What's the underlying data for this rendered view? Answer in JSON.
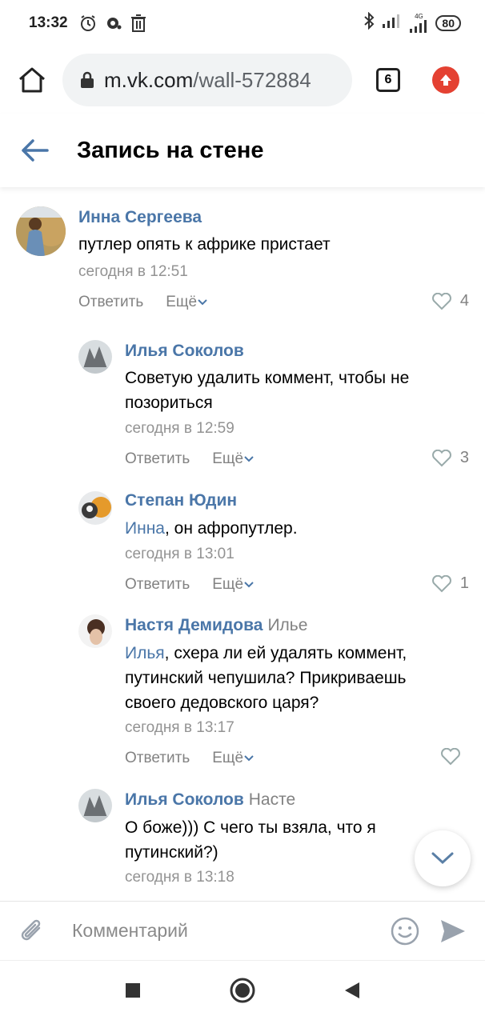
{
  "status_bar": {
    "time": "13:32",
    "battery": "80",
    "network": "4G",
    "icons": [
      "alarm-icon",
      "notification-icon",
      "trash-icon",
      "bluetooth-icon",
      "signal-icon",
      "signal-4g-icon",
      "battery-icon"
    ]
  },
  "browser": {
    "url_host": "m.vk.com",
    "url_path": "/wall-572884",
    "tab_count": "6",
    "accent": "#e44132"
  },
  "header": {
    "title": "Запись на стене"
  },
  "colors": {
    "link": "#4a76a8",
    "muted": "#939393"
  },
  "comments": [
    {
      "author": "Инна Сергеева",
      "reply_to": "",
      "mention": "",
      "text": "путлер опять к африке пристает",
      "date": "сегодня в 12:51",
      "reply_label": "Ответить",
      "more_label": "Ещё",
      "likes": "4"
    },
    {
      "author": "Илья Соколов",
      "reply_to": "",
      "mention": "",
      "text": "Советую удалить коммент, чтобы не позориться",
      "date": "сегодня в 12:59",
      "reply_label": "Ответить",
      "more_label": "Ещё",
      "likes": "3"
    },
    {
      "author": "Степан Юдин",
      "reply_to": "",
      "mention": "Инна",
      "text": ", он афропутлер.",
      "date": "сегодня в 13:01",
      "reply_label": "Ответить",
      "more_label": "Ещё",
      "likes": "1"
    },
    {
      "author": "Настя Демидова",
      "reply_to": "Илье",
      "mention": "Илья",
      "text": ", схера ли ей удалять коммент, путинский чепушила? Прикриваешь своего дедовского царя?",
      "date": "сегодня в 13:17",
      "reply_label": "Ответить",
      "more_label": "Ещё",
      "likes": ""
    },
    {
      "author": "Илья Соколов",
      "reply_to": "Насте",
      "mention": "",
      "text": "О боже))) С чего ты взяла, что я путинский?)",
      "date": "сегодня в 13:18",
      "reply_label": "",
      "more_label": "",
      "likes": ""
    }
  ],
  "composer": {
    "placeholder": "Комментарий"
  }
}
